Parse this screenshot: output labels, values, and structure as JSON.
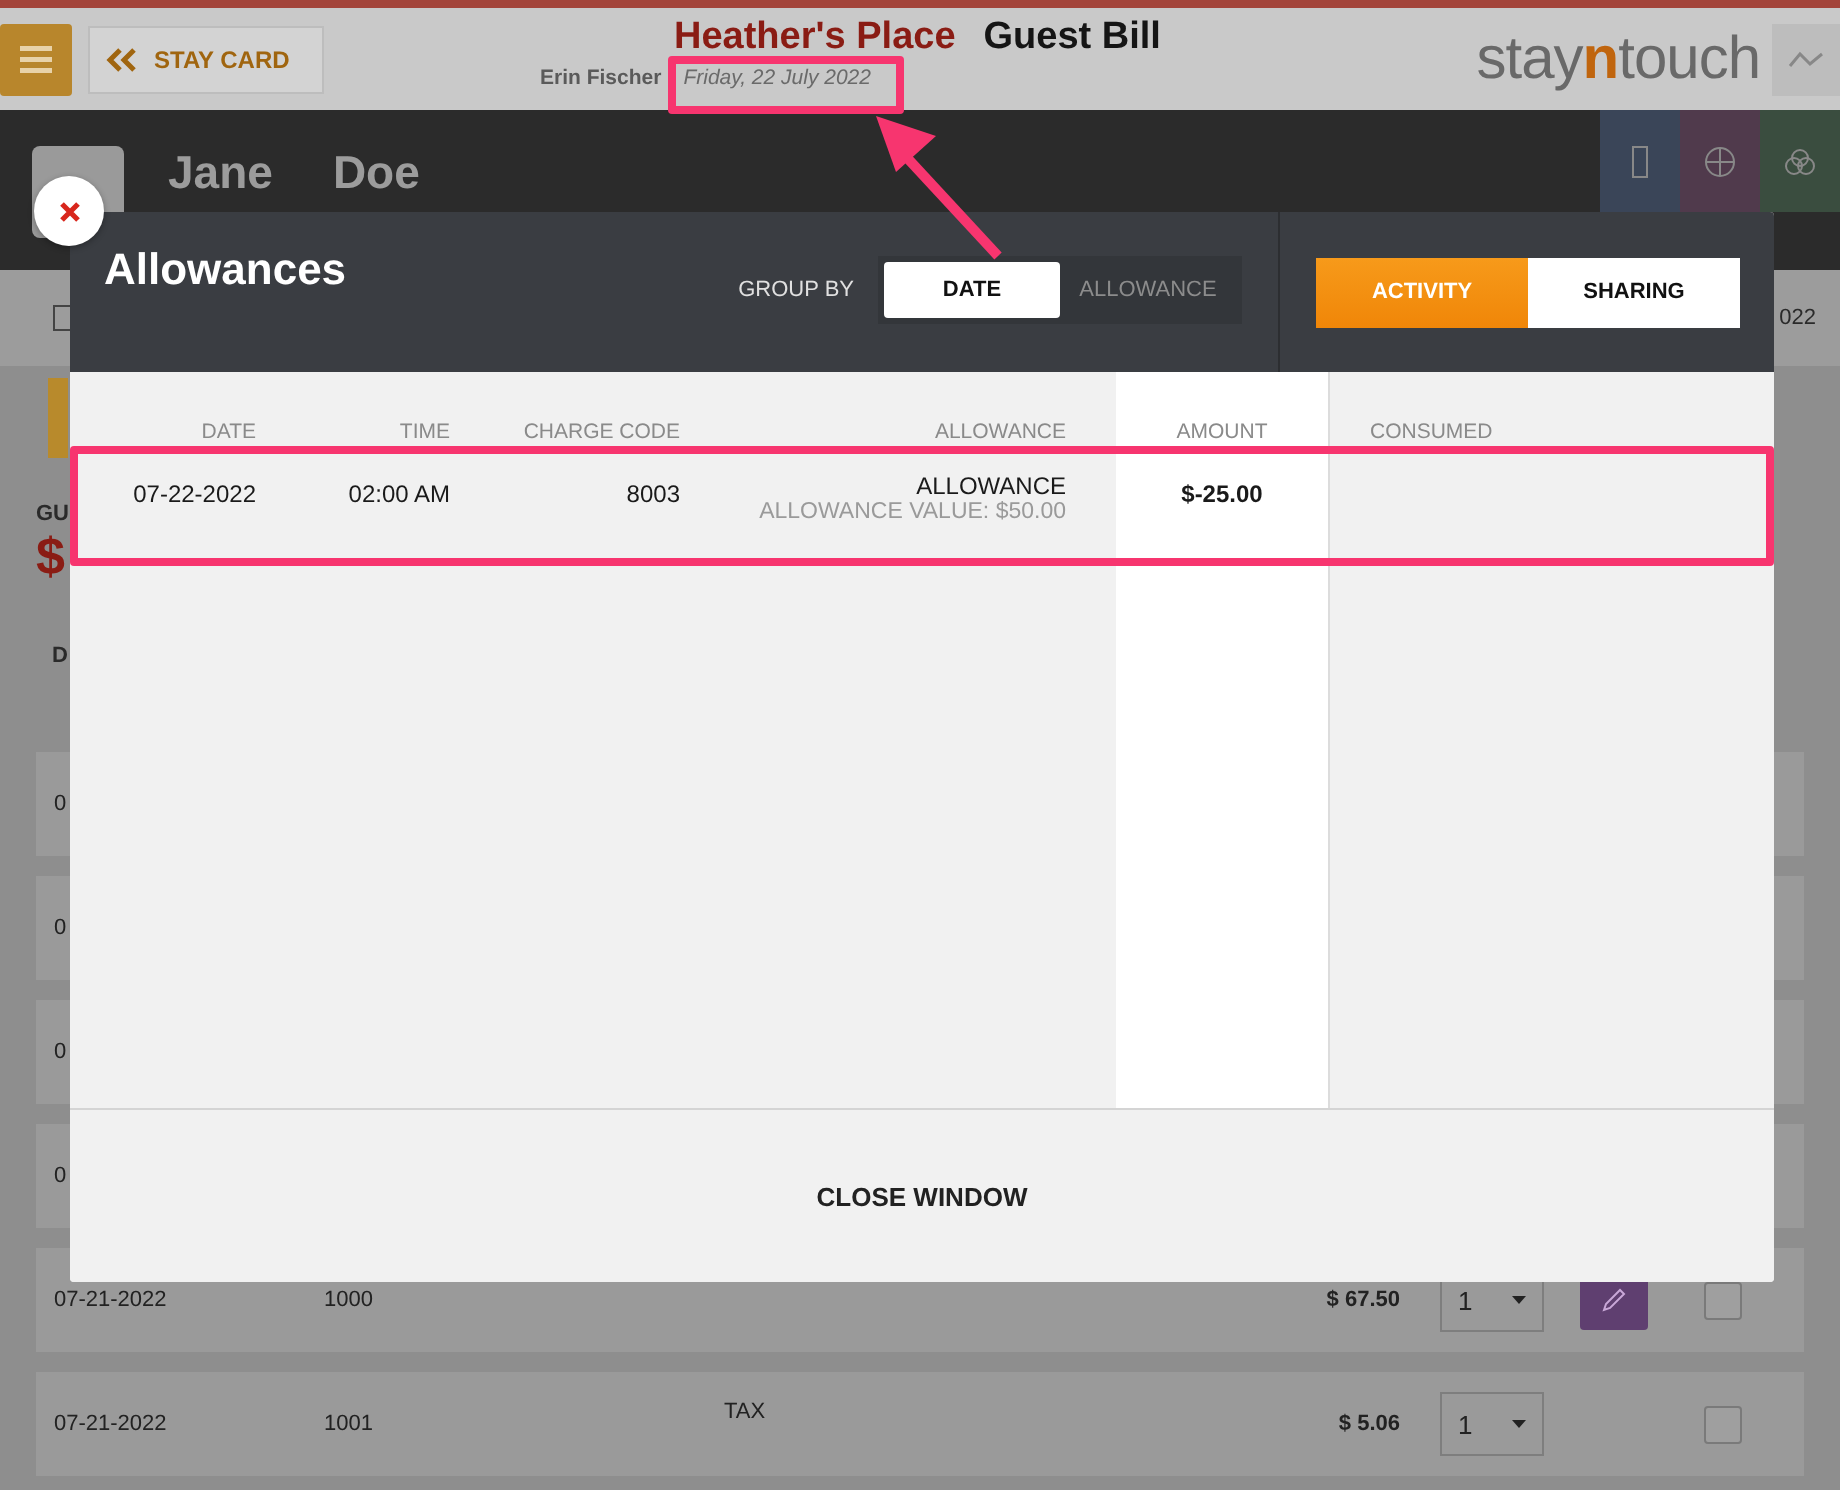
{
  "app_header": {
    "back_button": "STAY CARD",
    "hotel": "Heather's Place",
    "page_title": "Guest Bill",
    "user": "Erin Fischer",
    "date": "Friday, 22 July 2022",
    "logo": [
      "stay",
      "n",
      "touch"
    ]
  },
  "guest": {
    "first_name": "Jane",
    "last_name": "Doe"
  },
  "bill": {
    "date_fragment": "022",
    "label_fragment": "GU",
    "amount_fragment": "$",
    "column_fragment": "D",
    "rows": [
      {
        "kind": "covered",
        "date": "0"
      },
      {
        "kind": "covered",
        "date": "0"
      },
      {
        "kind": "covered",
        "date": "0"
      },
      {
        "kind": "covered",
        "date": "0"
      },
      {
        "kind": "full",
        "date": "07-21-2022",
        "code": "1000",
        "amount": "$ 67.50",
        "quantity": "1",
        "editable": true,
        "checked": false
      },
      {
        "kind": "full",
        "date": "07-21-2022",
        "code": "1001",
        "description": "TAX",
        "amount": "$ 5.06",
        "quantity": "1",
        "editable": false,
        "checked": false
      }
    ]
  },
  "modal": {
    "title": "Allowances",
    "group_by_label": "GROUP BY",
    "group_by": [
      {
        "label": "DATE",
        "selected": true
      },
      {
        "label": "ALLOWANCE",
        "selected": false
      }
    ],
    "views": [
      {
        "label": "ACTIVITY",
        "selected": true
      },
      {
        "label": "SHARING",
        "selected": false
      }
    ],
    "columns": [
      "DATE",
      "TIME",
      "CHARGE CODE",
      "ALLOWANCE",
      "AMOUNT",
      "CONSUMED"
    ],
    "rows": [
      {
        "date": "07-22-2022",
        "time": "02:00 AM",
        "charge_code": "8003",
        "allowance": "ALLOWANCE",
        "allowance_value": "ALLOWANCE VALUE: $50.00",
        "amount": "$-25.00"
      }
    ],
    "close_label": "CLOSE WINDOW"
  }
}
